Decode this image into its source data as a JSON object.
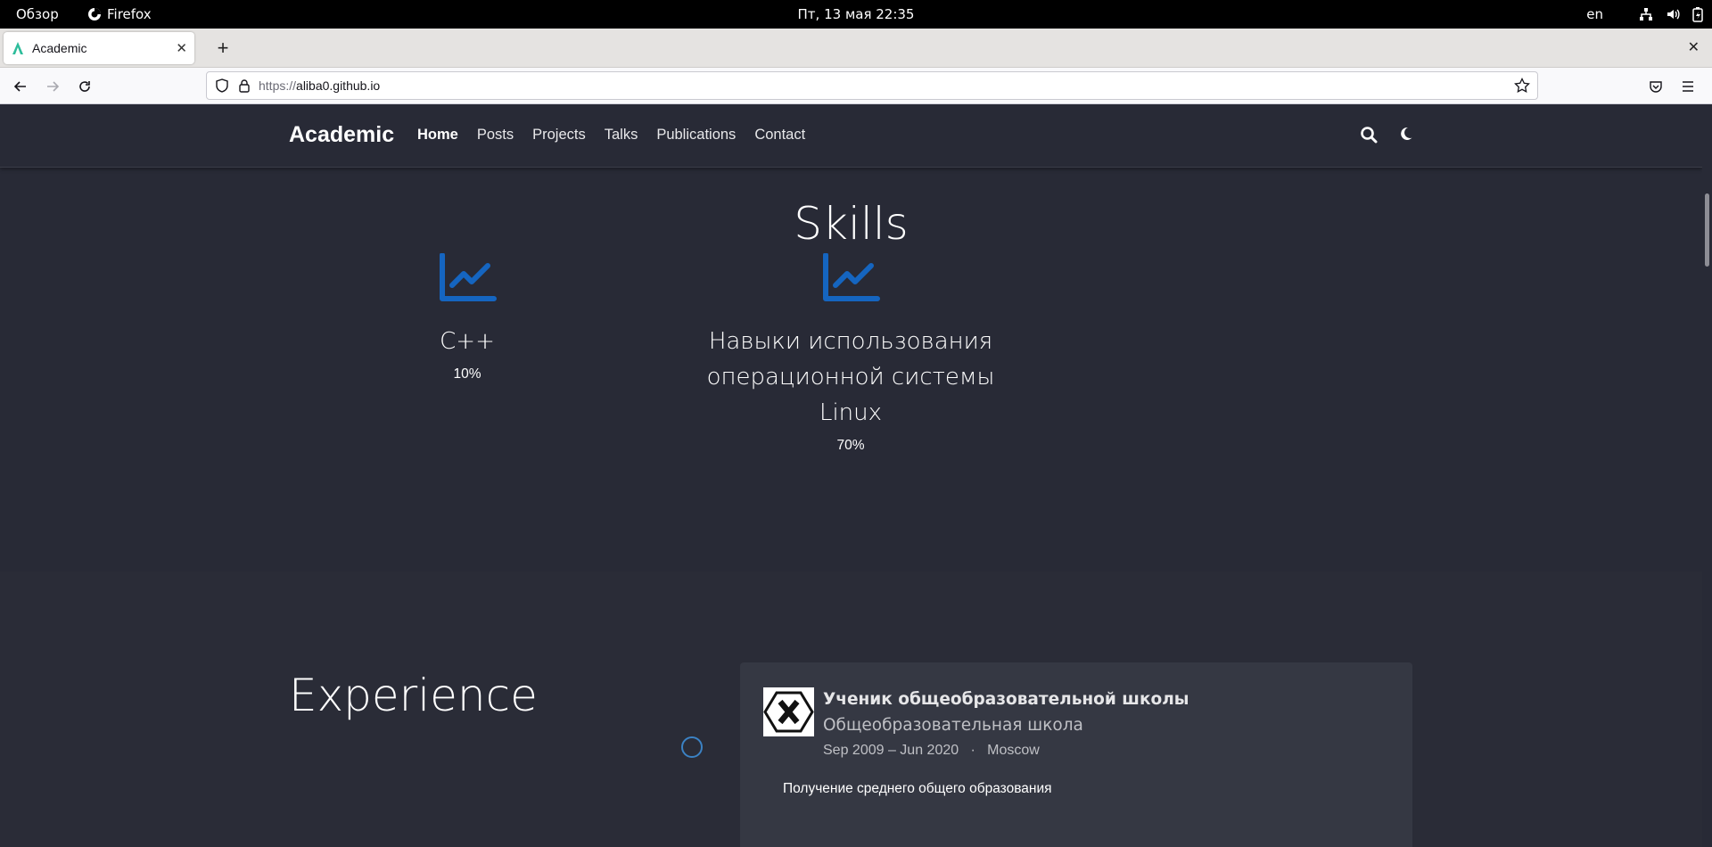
{
  "system": {
    "activities": "Обзор",
    "app_name": "Firefox",
    "clock": "Пт, 13 мая  22:35",
    "lang": "en"
  },
  "browser": {
    "tab_title": "Academic",
    "url_proto": "https://",
    "url_host": "aliba0.github.io"
  },
  "site": {
    "brand": "Academic",
    "menu": [
      "Home",
      "Posts",
      "Projects",
      "Talks",
      "Publications",
      "Contact"
    ],
    "active_menu": "Home"
  },
  "skills": {
    "title": "Skills",
    "items": [
      {
        "name": "C++",
        "percent": "10%",
        "icon": "chart-line-icon"
      },
      {
        "name": "Навыки использования операционной системы Linux",
        "percent": "70%",
        "icon": "chart-line-icon"
      }
    ]
  },
  "experience": {
    "title": "Experience",
    "items": [
      {
        "role": "Ученик общеобразовательной школы",
        "org": "Общеобразовательная школа",
        "dates": "Sep 2009 – Jun 2020",
        "location": "Moscow",
        "description": "Получение среднего общего образования",
        "logo": "x-hexagon-logo"
      }
    ]
  },
  "colors": {
    "page_bg": "#282a36",
    "accent": "#1565c0",
    "card_bg": "#353843"
  }
}
